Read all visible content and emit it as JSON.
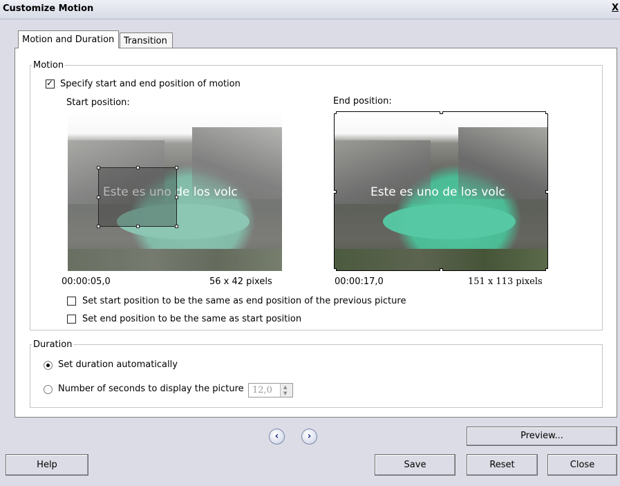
{
  "window": {
    "title": "Customize Motion",
    "close_label": "X"
  },
  "tabs": [
    {
      "label": "Motion and Duration",
      "active": true
    },
    {
      "label": "Transition",
      "active": false
    }
  ],
  "motion": {
    "group_label": "Motion",
    "specify_checkbox": {
      "label": "Specify start and end position of motion",
      "checked": true
    },
    "start": {
      "label": "Start position:",
      "overlay_text": "Este es uno de los volc",
      "time": "00:00:05,0",
      "size": "56 x 42 pixels"
    },
    "end": {
      "label": "End position:",
      "overlay_text": "Este es uno de los volc",
      "time": "00:00:17,0",
      "size": "151 x 113 pixels"
    },
    "same_as_previous": {
      "label": "Set start position to be the same as end position of the previous picture",
      "checked": false
    },
    "same_as_start": {
      "label": "Set end position to be the same as start position",
      "checked": false
    }
  },
  "duration": {
    "group_label": "Duration",
    "auto": {
      "label": "Set duration automatically",
      "selected": true
    },
    "manual": {
      "label": "Number of seconds to display the picture",
      "selected": false,
      "value": "12,0"
    }
  },
  "navigation": {
    "prev_icon": "chevron-left",
    "next_icon": "chevron-right"
  },
  "buttons": {
    "preview": "Preview...",
    "help": "Help",
    "save": "Save",
    "reset": "Reset",
    "close": "Close"
  }
}
